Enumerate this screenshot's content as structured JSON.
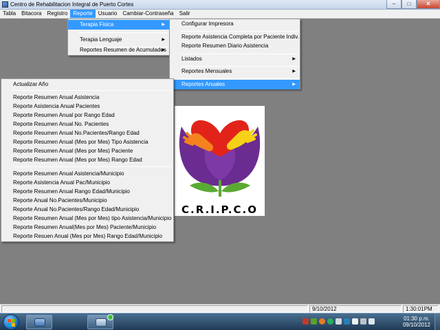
{
  "window": {
    "title": "Centro de Rehabilitacion Integral de Puerto Cortes",
    "minimize": "–",
    "maximize": "□",
    "close": "✕"
  },
  "menubar": [
    {
      "label": "Tabla"
    },
    {
      "label": "Bitacora"
    },
    {
      "label": "Registro"
    },
    {
      "label": "Reporte"
    },
    {
      "label": "Usuario"
    },
    {
      "label": "Cambiar-Contraseña"
    },
    {
      "label": "Salir"
    }
  ],
  "reporte_menu": [
    {
      "label": "Terapia Fisica"
    },
    {
      "label": "Terapia Lenguaje"
    },
    {
      "label": "Reportes Resumen de Acumulados"
    }
  ],
  "terapia_fisica_menu": [
    {
      "label": "Configurar Impresora"
    },
    {
      "label": "Reporte Asistencia Completa por Paciente Indiv."
    },
    {
      "label": "Reporte Resumen Diario Asistencia"
    },
    {
      "label": "Listados"
    },
    {
      "label": "Reportes Mensuales"
    },
    {
      "label": "Reportes Anuales"
    }
  ],
  "anuales_menu": [
    {
      "label": "Actualizar Año"
    },
    {
      "label": "Reporte Resumen Anual Asistencia"
    },
    {
      "label": "Reporte Asistencia Anual Pacientes"
    },
    {
      "label": "Reporte Resumen Anual por Rango Edad"
    },
    {
      "label": "Reporte Resumen Anual No. Pacientes"
    },
    {
      "label": "Reporte Resumen Anual No.Pacientes/Rango Edad"
    },
    {
      "label": "Reporte Resumen Anual (Mes por Mes) Tipo Asistencia"
    },
    {
      "label": "Reporte Resumen Anual (Mes por Mes) Paciente"
    },
    {
      "label": "Reporte Resumen Anual (Mes por Mes) Rango Edad"
    },
    {
      "label": "Reporte Resumen Anual Asistencia/Municipio"
    },
    {
      "label": "Reporte Asistencia Anual Pac/Municipio"
    },
    {
      "label": "Reporte Resumen Anual Rango Edad/Municipio"
    },
    {
      "label": "Reporte Anual No.Pacientes/Municipio"
    },
    {
      "label": "Reporte Anual No.Pacientes/Rango Edad/Municipio"
    },
    {
      "label": "Reporte Resumen Anual (Mes por Mes) tipo Asistencia/Municipio"
    },
    {
      "label": "Reporte Resumen Anual(Mes por Mes) Paciente/Municipio"
    },
    {
      "label": "Reporte Resuen Anual (Mes por Mes) Rango Edad/Municipio"
    }
  ],
  "logo": {
    "text": "C.R.I.P.C.O"
  },
  "statusbar": {
    "date": "9/10/2012",
    "time": "1:30:01PM"
  },
  "taskbar": {
    "clock_time": "01:30 p.m.",
    "clock_date": "09/10/2012",
    "icons": [
      "start-orb-icon",
      "app-window-icon",
      "remote-desktop-icon"
    ]
  },
  "colors": {
    "highlight": "#3399ff",
    "desktop": "#808080",
    "logo_purple": "#6a2c91",
    "logo_red": "#e2231a",
    "logo_green": "#5aaa32"
  }
}
